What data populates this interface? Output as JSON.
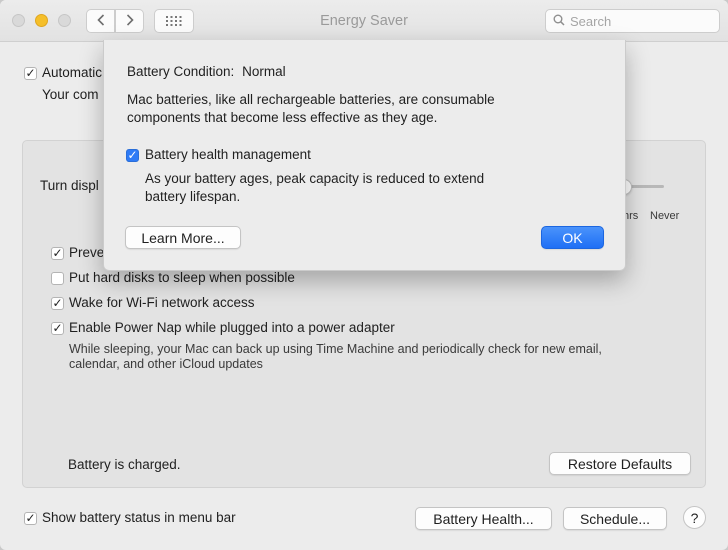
{
  "window": {
    "title": "Energy Saver"
  },
  "search": {
    "placeholder": "Search"
  },
  "background": {
    "auto_graphics_label": "Automatic",
    "auto_graphics_desc": "Your com",
    "turn_display_label": "Turn displ",
    "slider_labels": {
      "hrs": "hrs",
      "never": "Never"
    },
    "prevent_label": "Preve",
    "options": [
      {
        "label": "Put hard disks to sleep when possible",
        "checked": false
      },
      {
        "label": "Wake for Wi-Fi network access",
        "checked": true
      },
      {
        "label": "Enable Power Nap while plugged into a power adapter",
        "checked": true
      }
    ],
    "power_nap_desc_1": "While sleeping, your Mac can back up using Time Machine and periodically check for new email,",
    "power_nap_desc_2": "calendar, and other iCloud updates",
    "battery_status": "Battery is charged.",
    "restore_defaults": "Restore Defaults",
    "show_battery_status": "Show battery status in menu bar",
    "battery_health_button": "Battery Health...",
    "schedule_button": "Schedule...",
    "help": "?"
  },
  "sheet": {
    "condition_label": "Battery Condition:",
    "condition_value": "Normal",
    "desc_line1": "Mac batteries, like all rechargeable batteries, are consumable",
    "desc_line2": "components that become less effective as they age.",
    "bhm_label": "Battery health management",
    "bhm_desc_line1": "As your battery ages, peak capacity is reduced to extend",
    "bhm_desc_line2": "battery lifespan.",
    "learn_more": "Learn More...",
    "ok": "OK"
  },
  "colors": {
    "accent": "#2e7bf6",
    "window_bg": "#ececec"
  }
}
